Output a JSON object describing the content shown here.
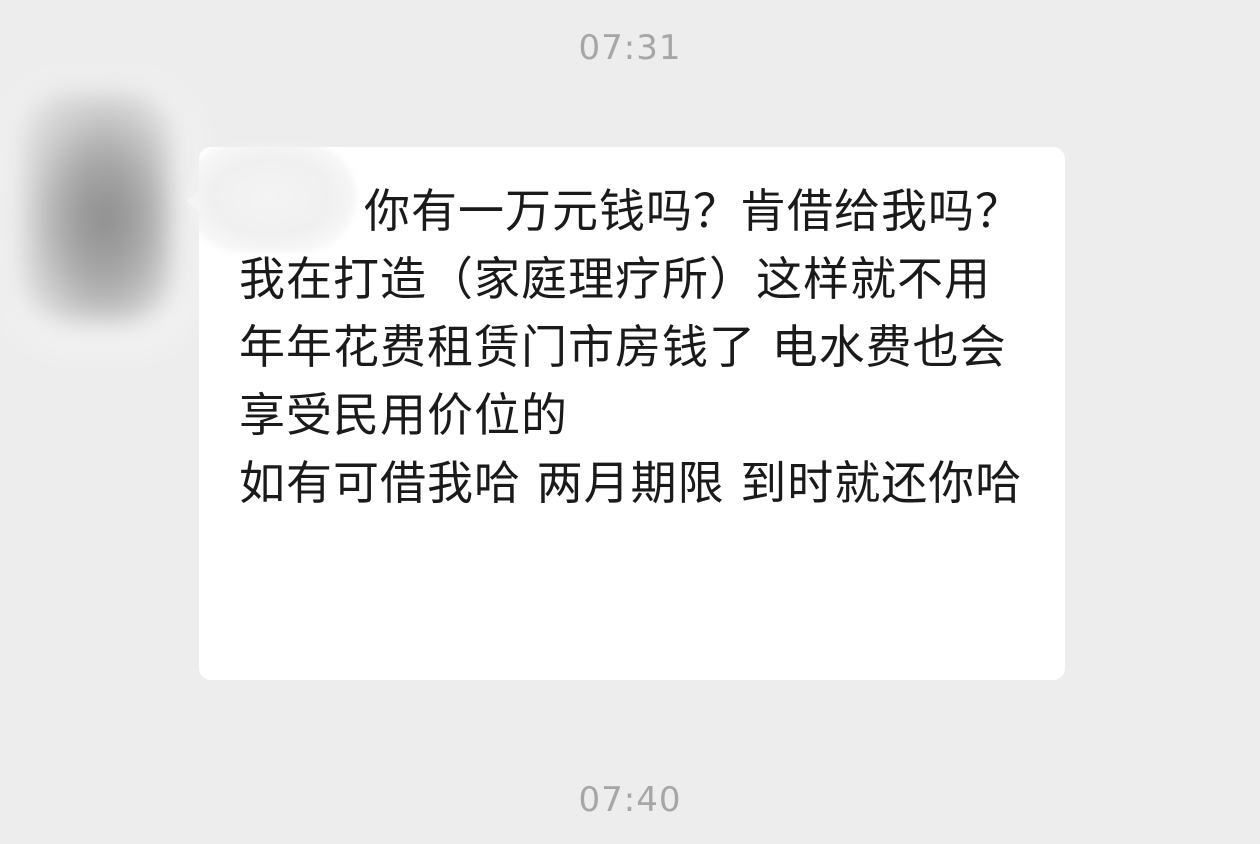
{
  "chat": {
    "timestamps": [
      "07:31",
      "07:40"
    ],
    "message": {
      "text": "        你有一万元钱吗？肯借给我吗？\n我在打造（家庭理疗所）这样就不用年年花费租赁门市房钱了 电水费也会享受民用价位的\n如有可借我哈 两月期限 到时就还你哈"
    },
    "icons": {
      "avatar": "blurred-avatar-icon"
    },
    "colors": {
      "background": "#ededed",
      "bubble": "#ffffff",
      "text": "#1a1a1a",
      "timestamp": "#a6a6a6"
    }
  }
}
